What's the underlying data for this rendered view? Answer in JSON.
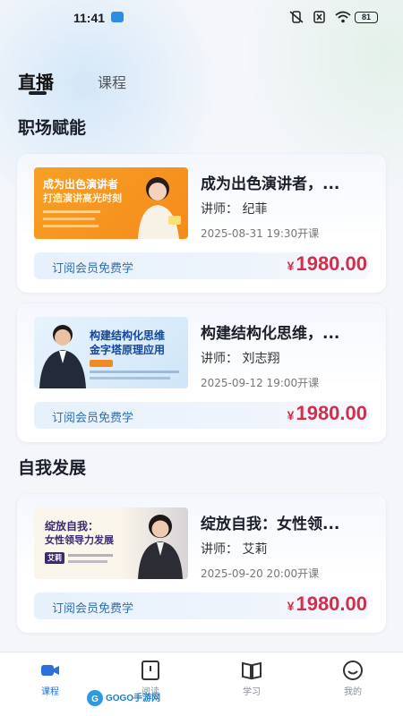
{
  "status_bar": {
    "time": "11:41",
    "battery": "81"
  },
  "tabs": [
    {
      "label": "直播"
    },
    {
      "label": "课程"
    }
  ],
  "sections": [
    {
      "title": "职场赋能"
    },
    {
      "title": "自我发展"
    }
  ],
  "courses": [
    {
      "title": "成为出色演讲者，...",
      "teacher": "讲师：  纪菲",
      "date": "2025-08-31 19:30开课",
      "subscribe": "订阅会员免费学",
      "price": "1980.00",
      "currency": "¥",
      "thumb_line1": "成为出色演讲者",
      "thumb_line2": "打造演讲高光时刻"
    },
    {
      "title": "构建结构化思维，...",
      "teacher": "讲师：  刘志翔",
      "date": "2025-09-12 19:00开课",
      "subscribe": "订阅会员免费学",
      "price": "1980.00",
      "currency": "¥",
      "thumb_line1": "构建结构化思维",
      "thumb_line2": "金字塔原理应用"
    },
    {
      "title": "绽放自我：女性领...",
      "teacher": "讲师：  艾莉",
      "date": "2025-09-20 20:00开课",
      "subscribe": "订阅会员免费学",
      "price": "1980.00",
      "currency": "¥",
      "thumb_line1": "绽放自我：",
      "thumb_line2": "女性领导力发展",
      "thumb_badge": "艾莉"
    }
  ],
  "bottom_nav": [
    {
      "label": "课程",
      "icon": "video-camera-icon",
      "active": true
    },
    {
      "label": "阅读",
      "icon": "book-icon",
      "active": false
    },
    {
      "label": "学习",
      "icon": "open-book-icon",
      "active": false
    },
    {
      "label": "我的",
      "icon": "smile-face-icon",
      "active": false
    }
  ],
  "watermark": "GOGO手游网",
  "colors": {
    "accent": "#2d6fdc",
    "price": "#d0304b",
    "subscribe_text": "#2f6fae"
  }
}
